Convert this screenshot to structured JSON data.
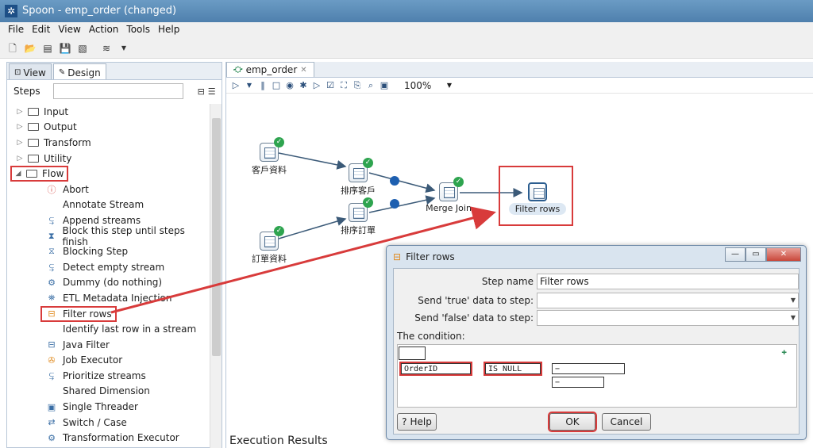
{
  "window": {
    "title": "Spoon - emp_order (changed)",
    "app_icon": "spoon-icon"
  },
  "menu": [
    "File",
    "Edit",
    "View",
    "Action",
    "Tools",
    "Help"
  ],
  "left_panel": {
    "tabs": [
      "View",
      "Design"
    ],
    "steps_label": "Steps",
    "categories": [
      "Input",
      "Output",
      "Transform",
      "Utility",
      "Flow"
    ],
    "flow_items": [
      "Abort",
      "Annotate Stream",
      "Append streams",
      "Block this step until steps finish",
      "Blocking Step",
      "Detect empty stream",
      "Dummy (do nothing)",
      "ETL Metadata Injection",
      "Filter rows",
      "Identify last row in a stream",
      "Java Filter",
      "Job Executor",
      "Prioritize streams",
      "Shared Dimension",
      "Single Threader",
      "Switch / Case",
      "Transformation Executor"
    ]
  },
  "right_panel": {
    "tab_label": "emp_order",
    "zoom": "100%",
    "steps": {
      "customer": "客戶資料",
      "sort_customer": "排序客戶",
      "sort_order": "排序訂單",
      "order": "訂單資料",
      "merge_join": "Merge Join",
      "filter_rows": "Filter rows"
    },
    "execution_results": "Execution Results"
  },
  "dialog": {
    "title": "Filter rows",
    "step_name_label": "Step name",
    "step_name_value": "Filter rows",
    "true_label": "Send 'true' data to step:",
    "false_label": "Send 'false' data to step:",
    "condition_label": "The condition:",
    "field": "OrderID",
    "operator": "IS NULL",
    "value1": "−",
    "value2": "−",
    "help": "Help",
    "ok": "OK",
    "cancel": "Cancel"
  }
}
